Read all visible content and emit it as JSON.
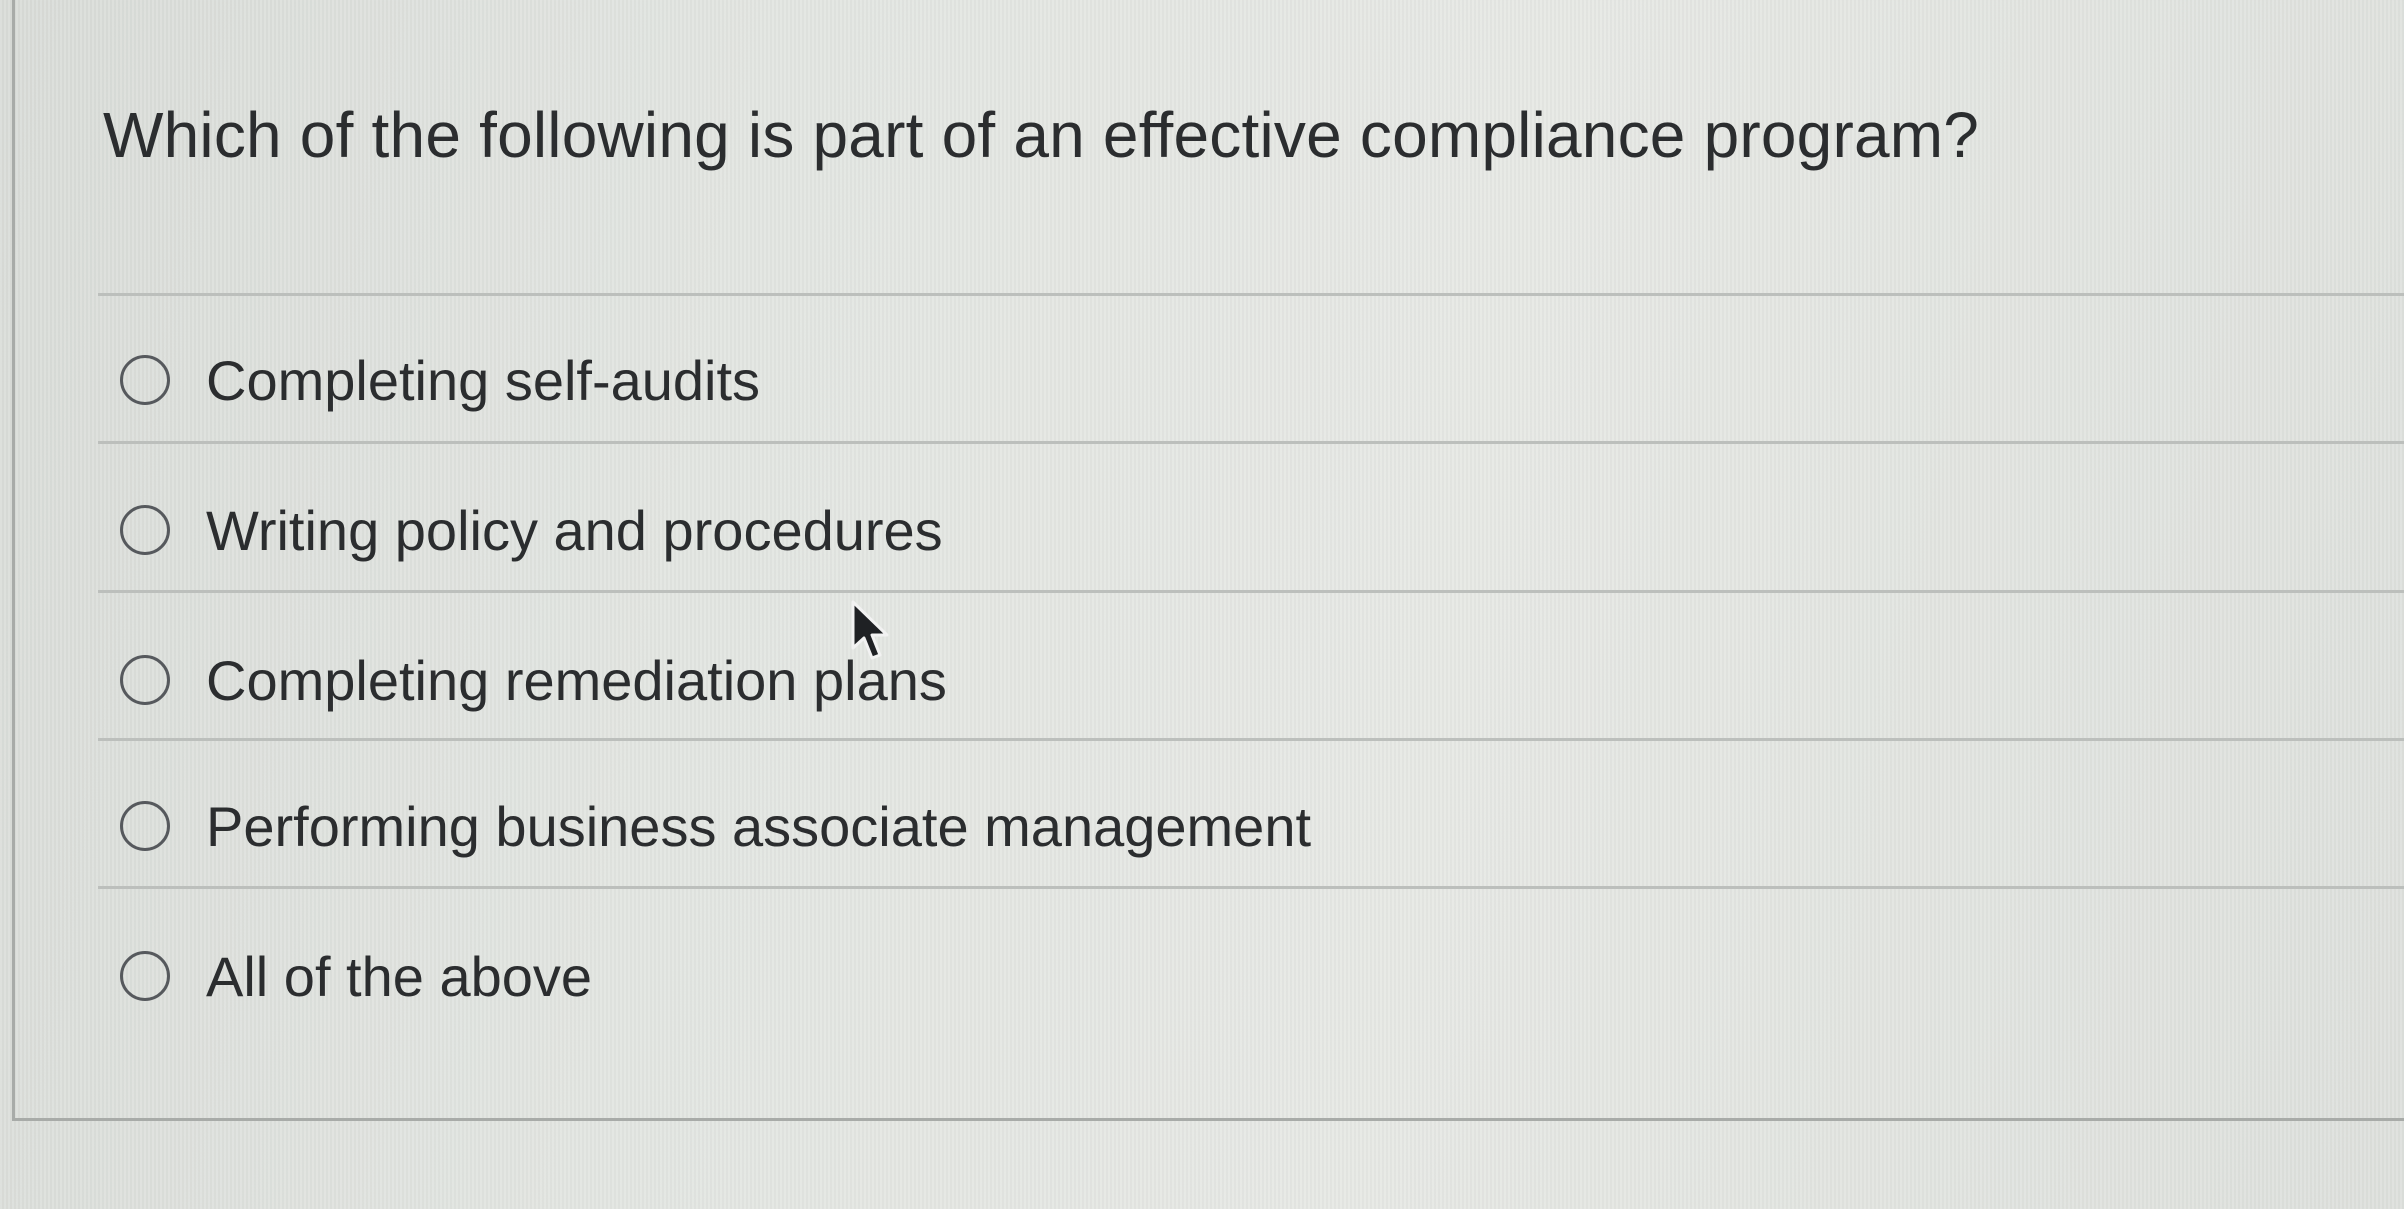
{
  "question": {
    "text": "Which of the following is part of an effective compliance program?"
  },
  "answers": [
    {
      "label": "Completing self-audits",
      "selected": false
    },
    {
      "label": "Writing policy and procedures",
      "selected": false
    },
    {
      "label": "Completing remediation plans",
      "selected": false
    },
    {
      "label": "Performing business associate management",
      "selected": false
    },
    {
      "label": "All of the above",
      "selected": false
    }
  ],
  "icons": {
    "radio": "radio-unselected-icon",
    "cursor": "arrow-cursor-icon"
  },
  "colors": {
    "text": "#2b2d2f",
    "radio_border": "#56595d",
    "divider": "#bcbfbc"
  }
}
